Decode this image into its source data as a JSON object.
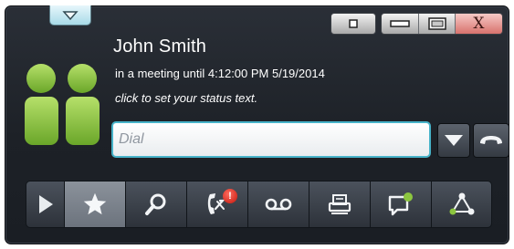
{
  "titlebar": {
    "collapse_icon": "triangle-down-icon",
    "pin_icon": "square-icon",
    "minimize_icon": "minimize-icon",
    "maximize_icon": "maximize-icon",
    "close_label": "X"
  },
  "user": {
    "name": "John Smith",
    "presence": "in a meeting until 4:12:00 PM 5/19/2014",
    "status_prompt": "click to set your status text.",
    "avatar_icon": "contacts-avatar-icon",
    "avatar_color": "#8cc63f"
  },
  "dial": {
    "placeholder": "Dial",
    "value": "",
    "dropdown_icon": "triangle-down-icon",
    "hangup_icon": "phone-hangup-icon"
  },
  "toolbar": {
    "items": [
      {
        "name": "expand",
        "icon": "play-icon"
      },
      {
        "name": "favorites",
        "icon": "star-icon",
        "active": true
      },
      {
        "name": "search",
        "icon": "magnifier-icon"
      },
      {
        "name": "call-history",
        "icon": "missed-call-icon",
        "badge": "!"
      },
      {
        "name": "voicemail",
        "icon": "voicemail-icon"
      },
      {
        "name": "fax",
        "icon": "fax-icon"
      },
      {
        "name": "chat",
        "icon": "chat-icon"
      },
      {
        "name": "conference",
        "icon": "network-icon"
      }
    ],
    "badge_color": "#d42215",
    "accent_green": "#8cc63f"
  },
  "colors": {
    "window_bg": "#1d2127",
    "focus_ring": "#47b3c9",
    "close_button": "#d8726d"
  }
}
